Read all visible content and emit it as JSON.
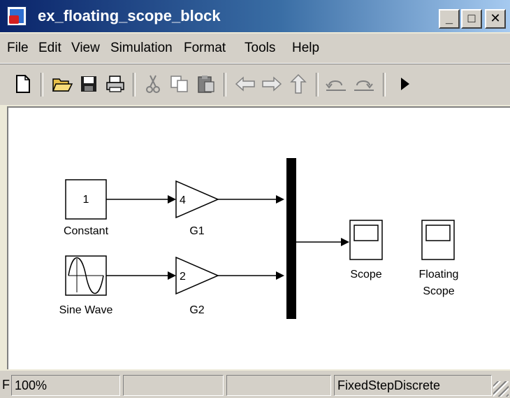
{
  "window": {
    "title": "ex_floating_scope_block",
    "controls": {
      "minimize": "_",
      "maximize": "□",
      "close": "✕"
    }
  },
  "menubar": {
    "items": [
      "File",
      "Edit",
      "View",
      "Simulation",
      "Format",
      "Tools",
      "Help"
    ]
  },
  "toolbar": {
    "icons": [
      "new-file-icon",
      "open-folder-icon",
      "save-icon",
      "print-icon",
      "cut-icon",
      "copy-icon",
      "paste-icon",
      "back-arrow-icon",
      "forward-arrow-icon",
      "up-arrow-icon",
      "undo-icon",
      "redo-icon",
      "start-simulation-icon"
    ]
  },
  "model": {
    "constant": {
      "label": "Constant",
      "value": "1"
    },
    "sine": {
      "label": "Sine Wave"
    },
    "g1": {
      "label": "G1",
      "gain": "4"
    },
    "g2": {
      "label": "G2",
      "gain": "2"
    },
    "scope": {
      "label": "Scope"
    },
    "floating_scope": {
      "label_line1": "Floating",
      "label_line2": "Scope"
    }
  },
  "statusbar": {
    "prefix": "F",
    "zoom": "100%",
    "pane2": "",
    "pane3": "",
    "solver": "FixedStepDiscrete"
  },
  "colors": {
    "title_start": "#0a246a",
    "title_end": "#a6caf0",
    "chrome": "#d4d0c8",
    "canvas": "#ffffff"
  }
}
